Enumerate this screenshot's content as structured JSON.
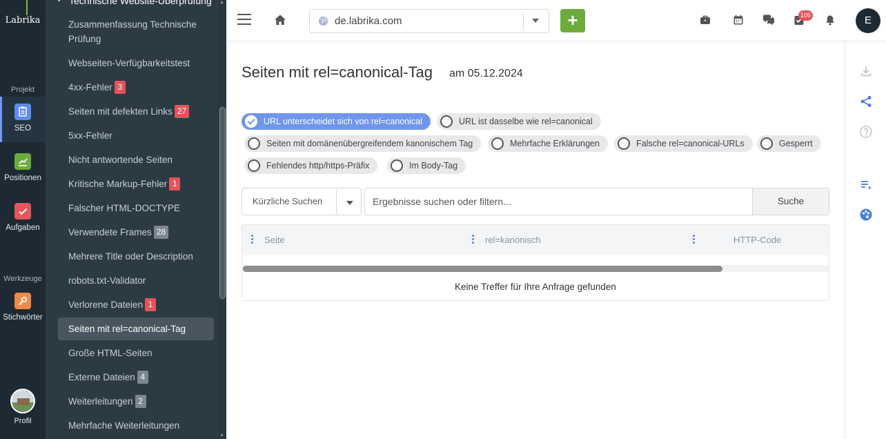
{
  "rail": {
    "logo": "Labrika",
    "sections": [
      {
        "label": "Projekt"
      },
      {
        "label": "Werkzeuge"
      }
    ],
    "items": [
      {
        "label": "SEO",
        "icon": "clipboard-icon",
        "color": "#5b8def"
      },
      {
        "label": "Positionen",
        "icon": "chart-icon",
        "color": "#6dac3c"
      },
      {
        "label": "Aufgaben",
        "icon": "check-icon",
        "color": "#e6545c"
      },
      {
        "label": "Stichwörter",
        "icon": "key-icon",
        "color": "#f08a47"
      }
    ],
    "profile_label": "Profil"
  },
  "subnav": {
    "group_title": "Technische Website-Überprüfung",
    "items": [
      {
        "label": "Zusammenfassung Technische Prüfung"
      },
      {
        "label": "Webseiten-Verfügbarkeitstest"
      },
      {
        "label": "4xx-Fehler",
        "badge": "3",
        "badge_color": "red"
      },
      {
        "label": "Seiten mit defekten Links",
        "badge": "27",
        "badge_color": "red"
      },
      {
        "label": "5xx-Fehler"
      },
      {
        "label": "Nicht antwortende Seiten"
      },
      {
        "label": "Kritische Markup-Fehler",
        "badge": "1",
        "badge_color": "red"
      },
      {
        "label": "Falscher HTML-DOCTYPE"
      },
      {
        "label": "Verwendete Frames",
        "badge": "28",
        "badge_color": "gray"
      },
      {
        "label": "Mehrere Title oder Description"
      },
      {
        "label": "robots.txt-Validator"
      },
      {
        "label": "Verlorene Dateien",
        "badge": "1",
        "badge_color": "red"
      },
      {
        "label": "Seiten mit rel=canonical-Tag",
        "active": true
      },
      {
        "label": "Große HTML-Seiten"
      },
      {
        "label": "Externe Dateien",
        "badge": "4",
        "badge_color": "gray"
      },
      {
        "label": "Weiterleitungen",
        "badge": "2",
        "badge_color": "gray"
      },
      {
        "label": "Mehrfache Weiterleitungen"
      }
    ]
  },
  "topbar": {
    "domain": "de.labrika.com",
    "add_label": "+",
    "notification_count": "105",
    "user_initial": "E"
  },
  "page": {
    "title": "Seiten mit rel=canonical-Tag",
    "date": "am 05.12.2024"
  },
  "filters": [
    {
      "label": "URL unterscheidet sich von rel=canonical",
      "checked": true
    },
    {
      "label": "URL ist dasselbe wie rel=canonical",
      "checked": false
    },
    {
      "label": "Seiten mit domänenübergreifendem kanonischem Tag",
      "checked": false
    },
    {
      "label": "Mehrfache Erklärungen",
      "checked": false
    },
    {
      "label": "Falsche rel=canonical-URLs",
      "checked": false
    },
    {
      "label": "Gesperrt",
      "checked": false
    },
    {
      "label": "Fehlendes http/https-Präfix",
      "checked": false
    },
    {
      "label": "Im Body-Tag",
      "checked": false
    }
  ],
  "search": {
    "recent_label": "Kürzliche Suchen",
    "placeholder": "Ergebnisse suchen oder filtern...",
    "button_label": "Suche"
  },
  "table": {
    "columns": [
      "Seite",
      "rel=kanonisch",
      "HTTP-Code"
    ],
    "empty_message": "Keine Treffer für Ihre Anfrage gefunden"
  }
}
